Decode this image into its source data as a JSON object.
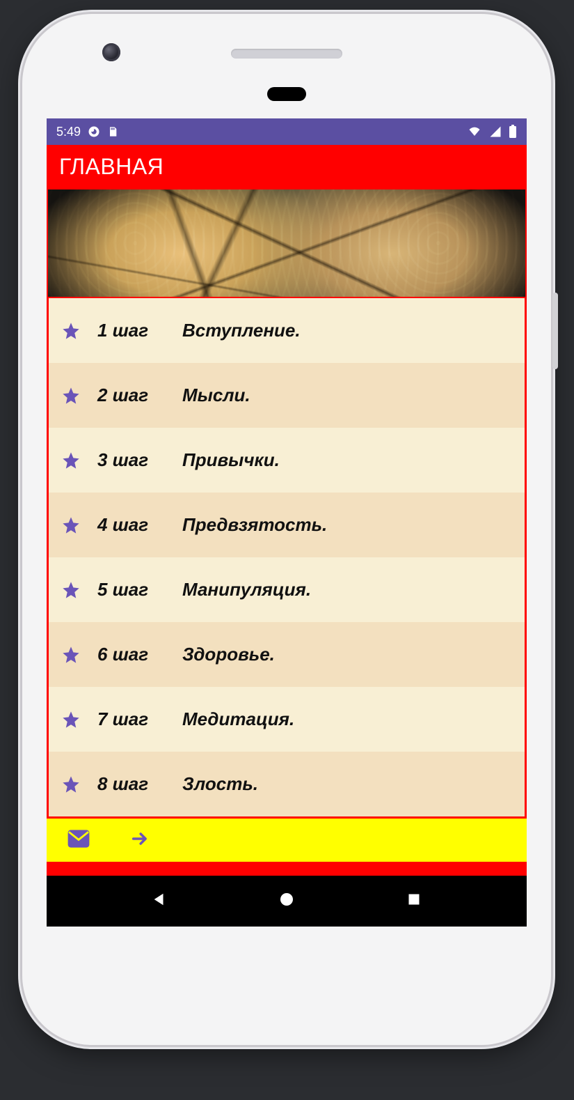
{
  "statusbar": {
    "time": "5:49"
  },
  "appbar": {
    "title": "ГЛАВНАЯ"
  },
  "colors": {
    "statusbar_bg": "#5b4fa2",
    "appbar_bg": "#FF0000",
    "list_border": "#FF0000",
    "row_even_bg": "#f8efd4",
    "row_odd_bg": "#f3e0bf",
    "toolbar_bg": "#FFFF00",
    "accent": "#6A54B8"
  },
  "list": {
    "items": [
      {
        "step": "1 шаг",
        "title": "Вступление."
      },
      {
        "step": "2 шаг",
        "title": "Мысли."
      },
      {
        "step": "3 шаг",
        "title": "Привычки."
      },
      {
        "step": "4 шаг",
        "title": "Предвзятость."
      },
      {
        "step": "5 шаг",
        "title": "Манипуляция."
      },
      {
        "step": "6 шаг",
        "title": "Здоровье."
      },
      {
        "step": "7 шаг",
        "title": "Медитация."
      },
      {
        "step": "8 шаг",
        "title": "Злость."
      }
    ]
  },
  "toolbar": {
    "icons": [
      "mail-icon",
      "arrow-right-icon"
    ]
  },
  "navbar": {
    "buttons": [
      "back",
      "home",
      "recent"
    ]
  }
}
